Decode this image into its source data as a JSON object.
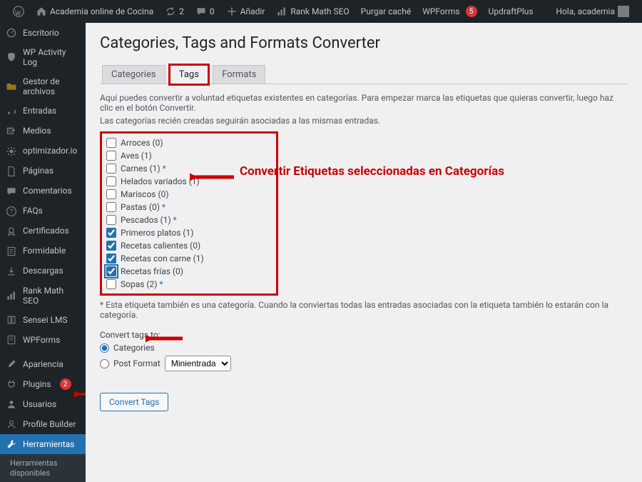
{
  "topbar": {
    "site_name": "Academia online de Cocina",
    "updates_count": "2",
    "comments_count": "0",
    "new_label": "Añadir",
    "items": [
      "Rank Math SEO",
      "Purgar caché",
      "WPForms"
    ],
    "wpforms_badge": "5",
    "updraft": "UpdraftPlus",
    "greeting": "Hola, academia"
  },
  "sidebar": {
    "items": [
      {
        "label": "Escritorio",
        "icon": "dashboard"
      },
      {
        "label": "WP Activity Log",
        "icon": "shield"
      },
      {
        "label": "Gestor de archivos",
        "icon": "folder",
        "folder": true
      },
      {
        "label": "Entradas",
        "icon": "pin"
      },
      {
        "label": "Medios",
        "icon": "media"
      },
      {
        "label": "optimizador.io",
        "icon": "gear"
      },
      {
        "label": "Páginas",
        "icon": "page"
      },
      {
        "label": "Comentarios",
        "icon": "comment"
      },
      {
        "label": "FAQs",
        "icon": "help"
      },
      {
        "label": "Certificados",
        "icon": "award"
      },
      {
        "label": "Formidable",
        "icon": "form"
      },
      {
        "label": "Descargas",
        "icon": "download"
      },
      {
        "label": "Rank Math SEO",
        "icon": "chart"
      },
      {
        "label": "Sensei LMS",
        "icon": "book"
      },
      {
        "label": "WPForms",
        "icon": "form2"
      },
      {
        "label": "Apariencia",
        "icon": "brush"
      },
      {
        "label": "Plugins",
        "icon": "plug",
        "badge": "2"
      },
      {
        "label": "Usuarios",
        "icon": "users"
      },
      {
        "label": "Profile Builder",
        "icon": "profile"
      },
      {
        "label": "Herramientas",
        "icon": "wrench",
        "current": true
      },
      {
        "label": "Herramientas disponibles",
        "sub": true
      }
    ]
  },
  "main": {
    "title": "Categories, Tags and Formats Converter",
    "tabs": [
      {
        "label": "Categories"
      },
      {
        "label": "Tags",
        "active": true
      },
      {
        "label": "Formats"
      }
    ],
    "intro1": "Aquí puedes convertir a voluntad etiquetas existentes en categorías. Para empezar marca las etiquetas que quieras convertir, luego haz clic en el botón Convertir.",
    "intro2": "Las categorías recién creadas seguirán asociadas a las mismas entradas.",
    "tags": [
      {
        "label": "Arroces (0)",
        "checked": false,
        "star": false
      },
      {
        "label": "Aves (1)",
        "checked": false,
        "star": false
      },
      {
        "label": "Carnes (1)",
        "checked": false,
        "star": true
      },
      {
        "label": "Helados variados (1)",
        "checked": false,
        "star": false
      },
      {
        "label": "Mariscos (0)",
        "checked": false,
        "star": false
      },
      {
        "label": "Pastas (0)",
        "checked": false,
        "star": true
      },
      {
        "label": "Pescados (1)",
        "checked": false,
        "star": true
      },
      {
        "label": "Primeros platos (1)",
        "checked": true,
        "star": false
      },
      {
        "label": "Recetas calientes (0)",
        "checked": true,
        "star": false
      },
      {
        "label": "Recetas con carne (1)",
        "checked": true,
        "star": false
      },
      {
        "label": "Recetas frías (0)",
        "checked": true,
        "star": false,
        "focused": true
      },
      {
        "label": "Sopas (2)",
        "checked": false,
        "star": true
      }
    ],
    "star_note": "* Esta etiqueta también es una categoría. Cuando la conviertas todas las entradas asociadas con la etiqueta también lo estarán con la categoría.",
    "convert_to_label": "Convert tags to:",
    "radio_categories": "Categories",
    "radio_postformat": "Post Format",
    "select_value": "Minientrada",
    "button": "Convert Tags"
  },
  "annotations": {
    "main_text": "Convertir Etiquetas seleccionadas en Categorías"
  }
}
